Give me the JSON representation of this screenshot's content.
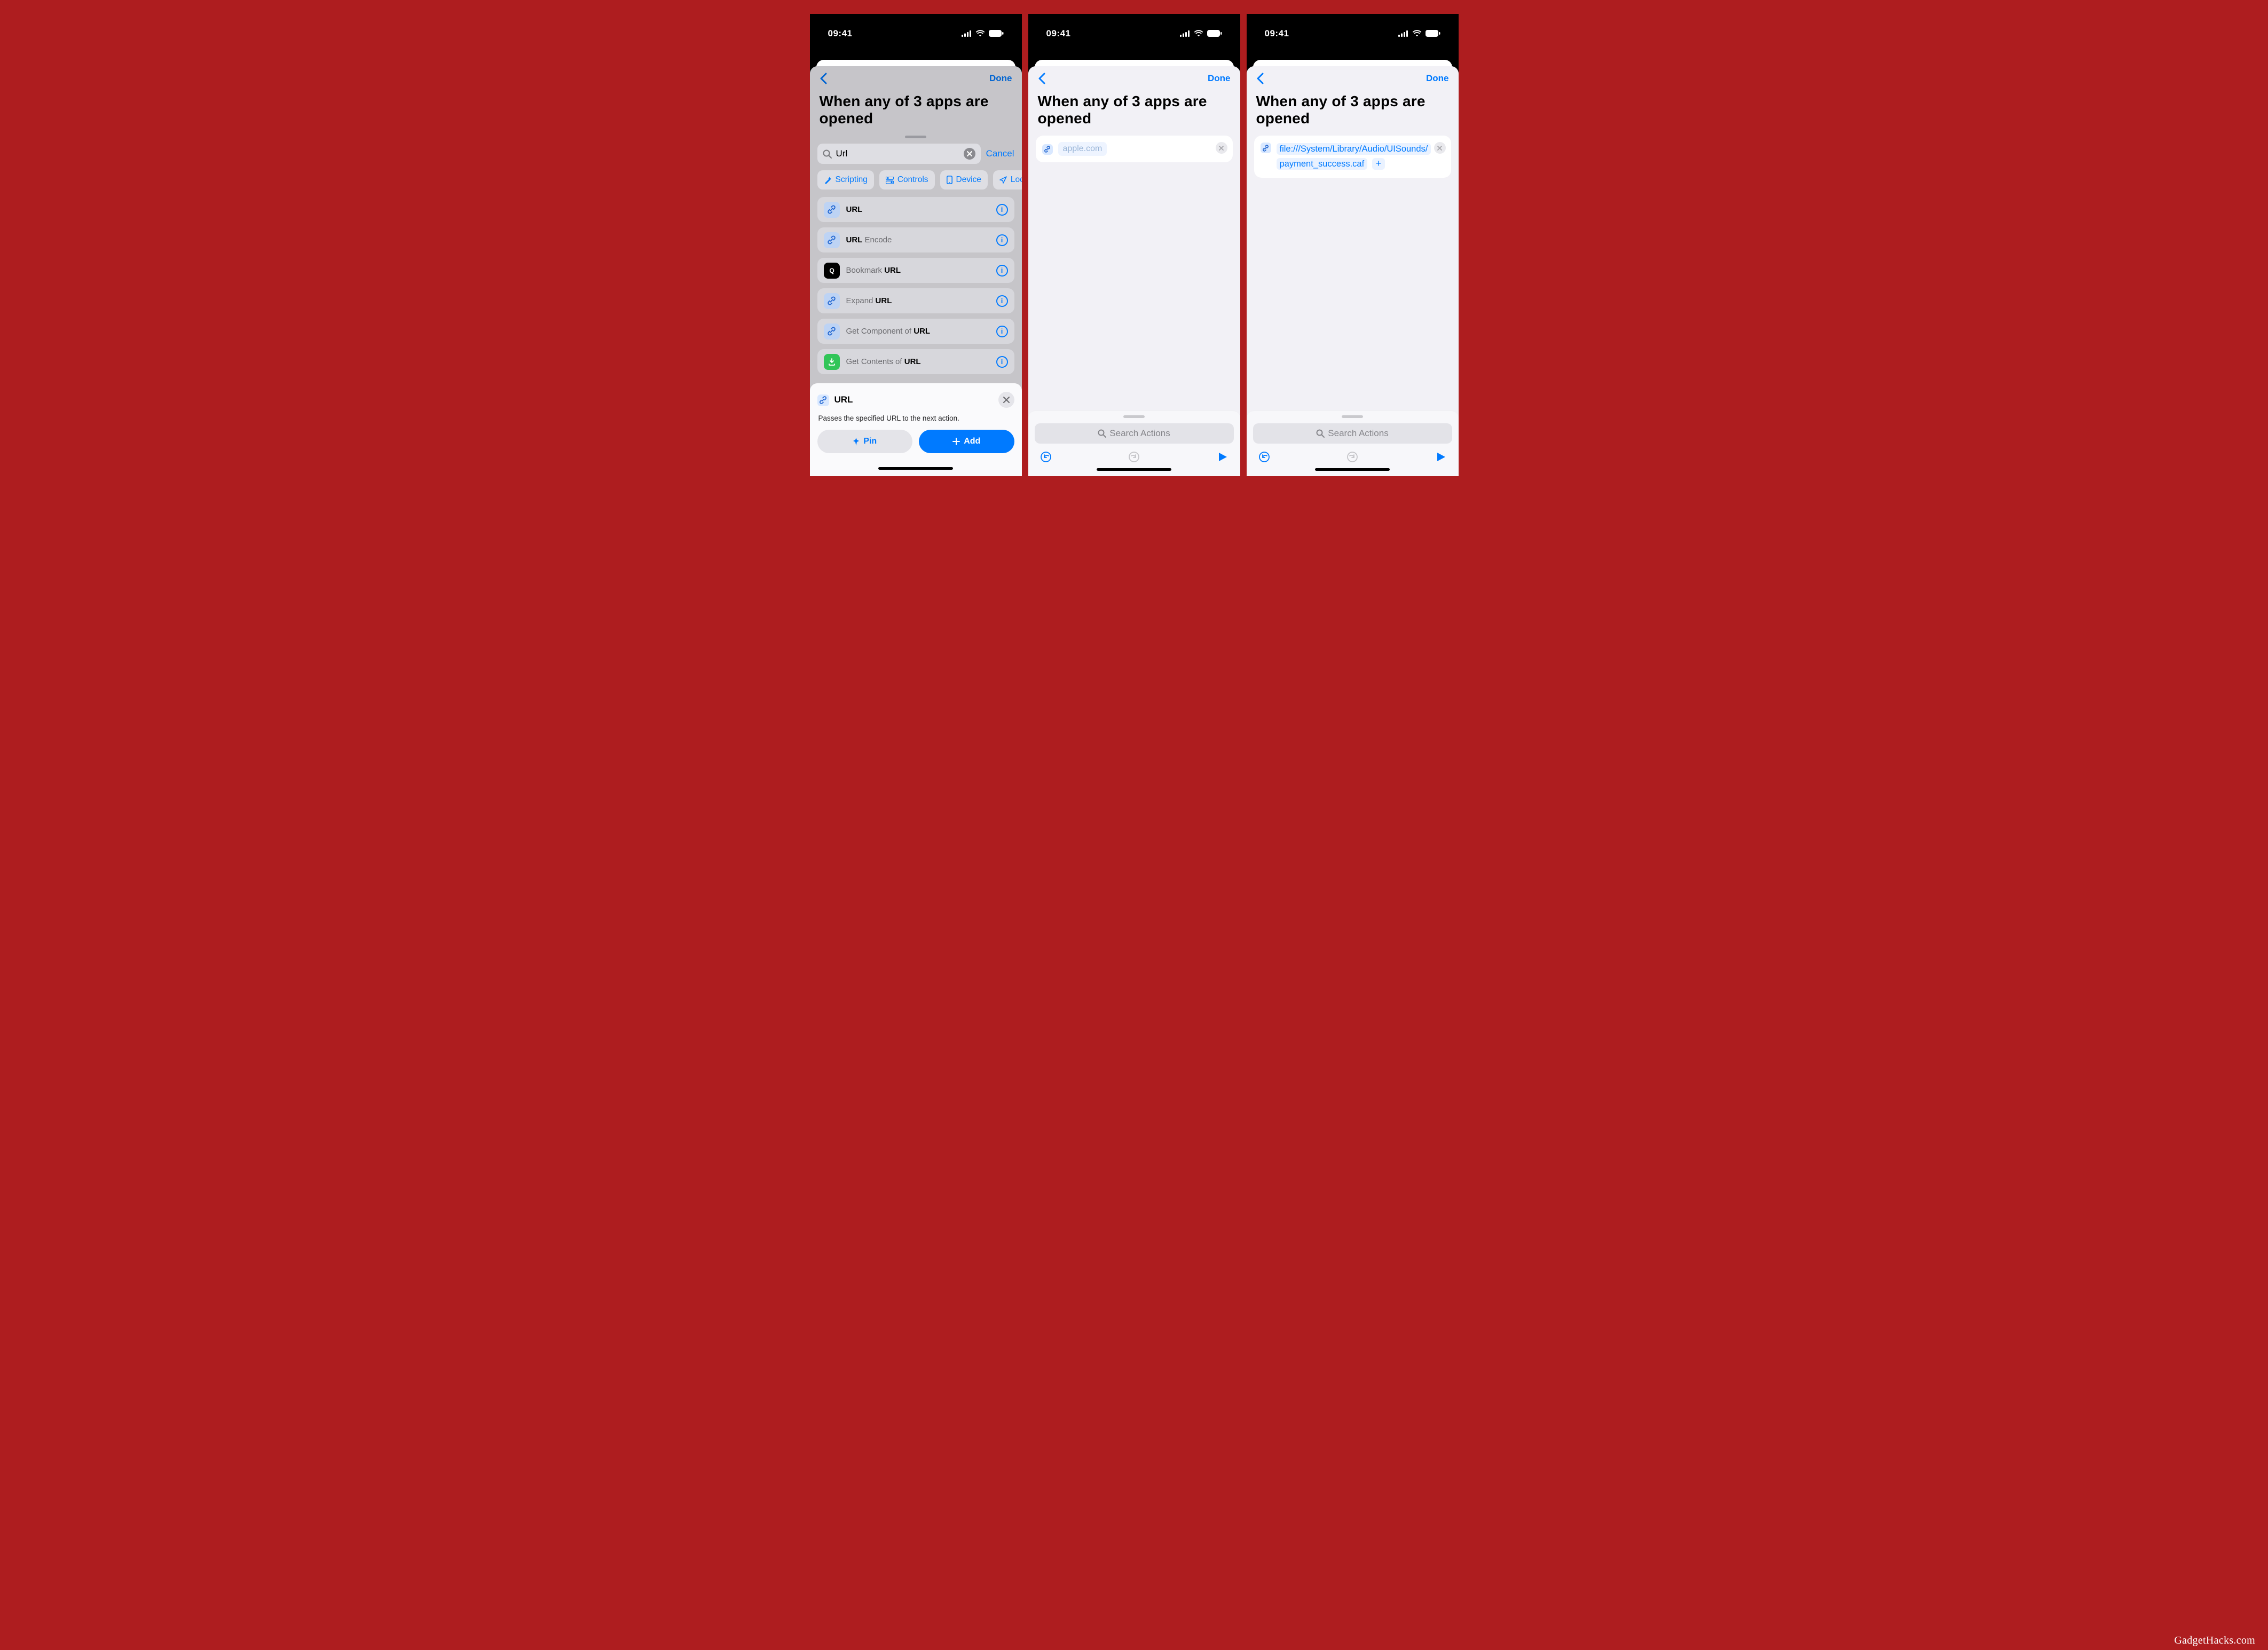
{
  "status": {
    "time": "09:41"
  },
  "nav": {
    "done": "Done"
  },
  "title": "When any of 3 apps are opened",
  "screen1": {
    "search_value": "Url",
    "cancel": "Cancel",
    "categories": [
      "Scripting",
      "Controls",
      "Device",
      "Loca"
    ],
    "results": [
      {
        "name": "URL",
        "prefix": "",
        "bold": "URL",
        "suffix": "",
        "icon": "link"
      },
      {
        "name": "URL Encode",
        "prefix": "",
        "bold": "URL",
        "suffix": " Encode",
        "icon": "link"
      },
      {
        "name": "Bookmark URL",
        "prefix": "Bookmark ",
        "bold": "URL",
        "suffix": "",
        "icon": "quote"
      },
      {
        "name": "Expand URL",
        "prefix": "Expand ",
        "bold": "URL",
        "suffix": "",
        "icon": "link"
      },
      {
        "name": "Get Component of URL",
        "prefix": "Get Component of ",
        "bold": "URL",
        "suffix": "",
        "icon": "link"
      },
      {
        "name": "Get Contents of URL",
        "prefix": "Get Contents of ",
        "bold": "URL",
        "suffix": "",
        "icon": "download"
      }
    ],
    "detail": {
      "title": "URL",
      "description": "Passes the specified URL to the next action.",
      "pin": "Pin",
      "add": "Add"
    }
  },
  "screen2": {
    "placeholder_url": "apple.com",
    "search_actions": "Search Actions"
  },
  "screen3": {
    "url_line1": "file:///System/Library/Audio/UISounds/",
    "url_line2": "payment_success.caf",
    "search_actions": "Search Actions"
  },
  "watermark": "GadgetHacks.com"
}
